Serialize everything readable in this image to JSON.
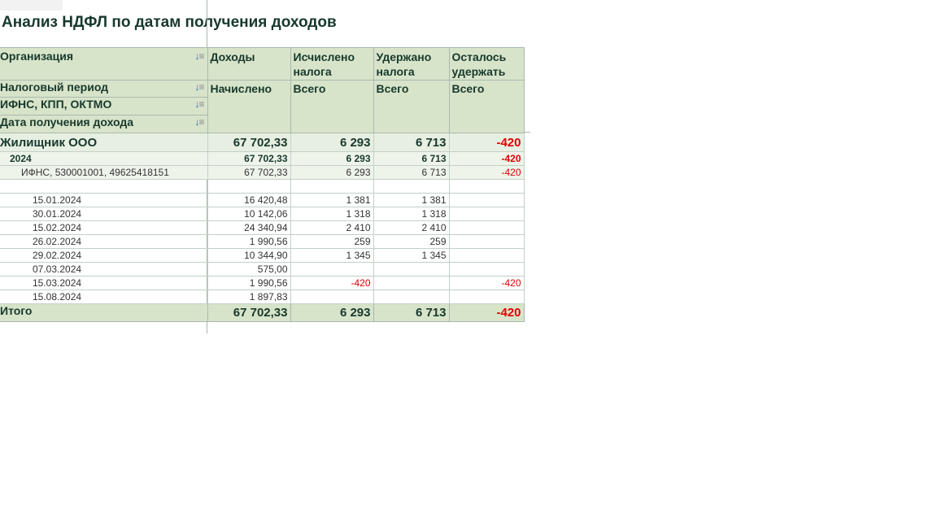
{
  "title": "Анализ НДФЛ по датам получения доходов",
  "header": {
    "group_labels": [
      "Организация",
      "Налоговый период",
      "ИФНС, КПП, ОКТМО",
      "Дата получения дохода"
    ],
    "columns": [
      {
        "top": "Доходы",
        "sub": "Начислено"
      },
      {
        "top": "Исчислено налога",
        "sub": "Всего"
      },
      {
        "top": "Удержано налога",
        "sub": "Всего"
      },
      {
        "top": "Осталось удержать",
        "sub": "Всего"
      }
    ],
    "sort_icon": "sort-down-icon"
  },
  "org": {
    "label": "Жилищник ООО",
    "income": "67 702,33",
    "calc": "6 293",
    "withheld": "6 713",
    "remain": "-420"
  },
  "year": {
    "label": "2024",
    "income": "67 702,33",
    "calc": "6 293",
    "withheld": "6 713",
    "remain": "-420"
  },
  "ifns": {
    "label": "ИФНС, 530001001, 49625418151",
    "income": "67 702,33",
    "calc": "6 293",
    "withheld": "6 713",
    "remain": "-420"
  },
  "rows": [
    {
      "date": "",
      "income": "",
      "calc": "",
      "withheld": "",
      "remain": ""
    },
    {
      "date": "15.01.2024",
      "income": "16 420,48",
      "calc": "1 381",
      "withheld": "1 381",
      "remain": ""
    },
    {
      "date": "30.01.2024",
      "income": "10 142,06",
      "calc": "1 318",
      "withheld": "1 318",
      "remain": ""
    },
    {
      "date": "15.02.2024",
      "income": "24 340,94",
      "calc": "2 410",
      "withheld": "2 410",
      "remain": ""
    },
    {
      "date": "26.02.2024",
      "income": "1 990,56",
      "calc": "259",
      "withheld": "259",
      "remain": ""
    },
    {
      "date": "29.02.2024",
      "income": "10 344,90",
      "calc": "1 345",
      "withheld": "1 345",
      "remain": ""
    },
    {
      "date": "07.03.2024",
      "income": "575,00",
      "calc": "",
      "withheld": "",
      "remain": ""
    },
    {
      "date": "15.03.2024",
      "income": "1 990,56",
      "calc": "-420",
      "withheld": "",
      "remain": "-420"
    },
    {
      "date": "15.08.2024",
      "income": "1 897,83",
      "calc": "",
      "withheld": "",
      "remain": ""
    }
  ],
  "total": {
    "label": "Итого",
    "income": "67 702,33",
    "calc": "6 293",
    "withheld": "6 713",
    "remain": "-420"
  },
  "colors": {
    "header_bg": "#d8e4ca",
    "negative": "#e00000",
    "title": "#17392c"
  }
}
